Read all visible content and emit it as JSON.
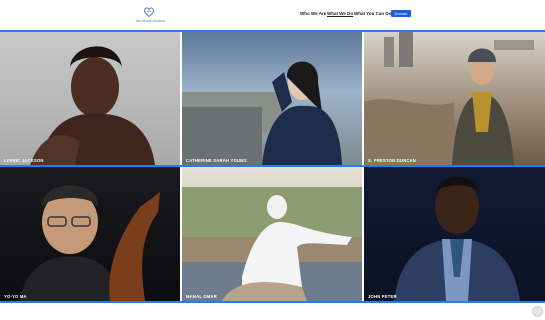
{
  "logo": {
    "text": "the hearts emotion"
  },
  "nav": {
    "items": [
      {
        "label": "Who We Are"
      },
      {
        "label": "What We Do"
      },
      {
        "label": "What You Can Do"
      }
    ],
    "donate_label": "Donate"
  },
  "tiles": [
    {
      "name": "LYRRIC JACKSON"
    },
    {
      "name": "CATHERINE SARAH YOUNG"
    },
    {
      "name": "S. PRESTON DUNCAN"
    },
    {
      "name": "YO-YO MA"
    },
    {
      "name": "MANAL OMAR"
    },
    {
      "name": "JOHN PETER"
    }
  ],
  "colors": {
    "accent": "#1a5fe0",
    "divider": "#2b7be3"
  }
}
